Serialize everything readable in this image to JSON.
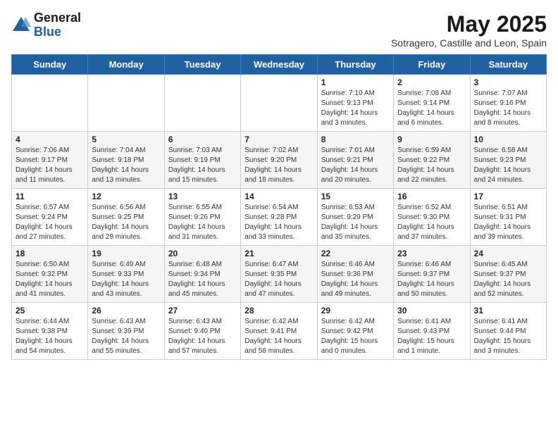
{
  "header": {
    "logo_general": "General",
    "logo_blue": "Blue",
    "month_year": "May 2025",
    "location": "Sotragero, Castille and Leon, Spain"
  },
  "weekdays": [
    "Sunday",
    "Monday",
    "Tuesday",
    "Wednesday",
    "Thursday",
    "Friday",
    "Saturday"
  ],
  "weeks": [
    [
      {
        "day": "",
        "info": ""
      },
      {
        "day": "",
        "info": ""
      },
      {
        "day": "",
        "info": ""
      },
      {
        "day": "",
        "info": ""
      },
      {
        "day": "1",
        "info": "Sunrise: 7:10 AM\nSunset: 9:13 PM\nDaylight: 14 hours\nand 3 minutes."
      },
      {
        "day": "2",
        "info": "Sunrise: 7:08 AM\nSunset: 9:14 PM\nDaylight: 14 hours\nand 6 minutes."
      },
      {
        "day": "3",
        "info": "Sunrise: 7:07 AM\nSunset: 9:16 PM\nDaylight: 14 hours\nand 8 minutes."
      }
    ],
    [
      {
        "day": "4",
        "info": "Sunrise: 7:06 AM\nSunset: 9:17 PM\nDaylight: 14 hours\nand 11 minutes."
      },
      {
        "day": "5",
        "info": "Sunrise: 7:04 AM\nSunset: 9:18 PM\nDaylight: 14 hours\nand 13 minutes."
      },
      {
        "day": "6",
        "info": "Sunrise: 7:03 AM\nSunset: 9:19 PM\nDaylight: 14 hours\nand 15 minutes."
      },
      {
        "day": "7",
        "info": "Sunrise: 7:02 AM\nSunset: 9:20 PM\nDaylight: 14 hours\nand 18 minutes."
      },
      {
        "day": "8",
        "info": "Sunrise: 7:01 AM\nSunset: 9:21 PM\nDaylight: 14 hours\nand 20 minutes."
      },
      {
        "day": "9",
        "info": "Sunrise: 6:59 AM\nSunset: 9:22 PM\nDaylight: 14 hours\nand 22 minutes."
      },
      {
        "day": "10",
        "info": "Sunrise: 6:58 AM\nSunset: 9:23 PM\nDaylight: 14 hours\nand 24 minutes."
      }
    ],
    [
      {
        "day": "11",
        "info": "Sunrise: 6:57 AM\nSunset: 9:24 PM\nDaylight: 14 hours\nand 27 minutes."
      },
      {
        "day": "12",
        "info": "Sunrise: 6:56 AM\nSunset: 9:25 PM\nDaylight: 14 hours\nand 29 minutes."
      },
      {
        "day": "13",
        "info": "Sunrise: 6:55 AM\nSunset: 9:26 PM\nDaylight: 14 hours\nand 31 minutes."
      },
      {
        "day": "14",
        "info": "Sunrise: 6:54 AM\nSunset: 9:28 PM\nDaylight: 14 hours\nand 33 minutes."
      },
      {
        "day": "15",
        "info": "Sunrise: 6:53 AM\nSunset: 9:29 PM\nDaylight: 14 hours\nand 35 minutes."
      },
      {
        "day": "16",
        "info": "Sunrise: 6:52 AM\nSunset: 9:30 PM\nDaylight: 14 hours\nand 37 minutes."
      },
      {
        "day": "17",
        "info": "Sunrise: 6:51 AM\nSunset: 9:31 PM\nDaylight: 14 hours\nand 39 minutes."
      }
    ],
    [
      {
        "day": "18",
        "info": "Sunrise: 6:50 AM\nSunset: 9:32 PM\nDaylight: 14 hours\nand 41 minutes."
      },
      {
        "day": "19",
        "info": "Sunrise: 6:49 AM\nSunset: 9:33 PM\nDaylight: 14 hours\nand 43 minutes."
      },
      {
        "day": "20",
        "info": "Sunrise: 6:48 AM\nSunset: 9:34 PM\nDaylight: 14 hours\nand 45 minutes."
      },
      {
        "day": "21",
        "info": "Sunrise: 6:47 AM\nSunset: 9:35 PM\nDaylight: 14 hours\nand 47 minutes."
      },
      {
        "day": "22",
        "info": "Sunrise: 6:46 AM\nSunset: 9:36 PM\nDaylight: 14 hours\nand 49 minutes."
      },
      {
        "day": "23",
        "info": "Sunrise: 6:46 AM\nSunset: 9:37 PM\nDaylight: 14 hours\nand 50 minutes."
      },
      {
        "day": "24",
        "info": "Sunrise: 6:45 AM\nSunset: 9:37 PM\nDaylight: 14 hours\nand 52 minutes."
      }
    ],
    [
      {
        "day": "25",
        "info": "Sunrise: 6:44 AM\nSunset: 9:38 PM\nDaylight: 14 hours\nand 54 minutes."
      },
      {
        "day": "26",
        "info": "Sunrise: 6:43 AM\nSunset: 9:39 PM\nDaylight: 14 hours\nand 55 minutes."
      },
      {
        "day": "27",
        "info": "Sunrise: 6:43 AM\nSunset: 9:40 PM\nDaylight: 14 hours\nand 57 minutes."
      },
      {
        "day": "28",
        "info": "Sunrise: 6:42 AM\nSunset: 9:41 PM\nDaylight: 14 hours\nand 58 minutes."
      },
      {
        "day": "29",
        "info": "Sunrise: 6:42 AM\nSunset: 9:42 PM\nDaylight: 15 hours\nand 0 minutes."
      },
      {
        "day": "30",
        "info": "Sunrise: 6:41 AM\nSunset: 9:43 PM\nDaylight: 15 hours\nand 1 minute."
      },
      {
        "day": "31",
        "info": "Sunrise: 6:41 AM\nSunset: 9:44 PM\nDaylight: 15 hours\nand 3 minutes."
      }
    ]
  ]
}
